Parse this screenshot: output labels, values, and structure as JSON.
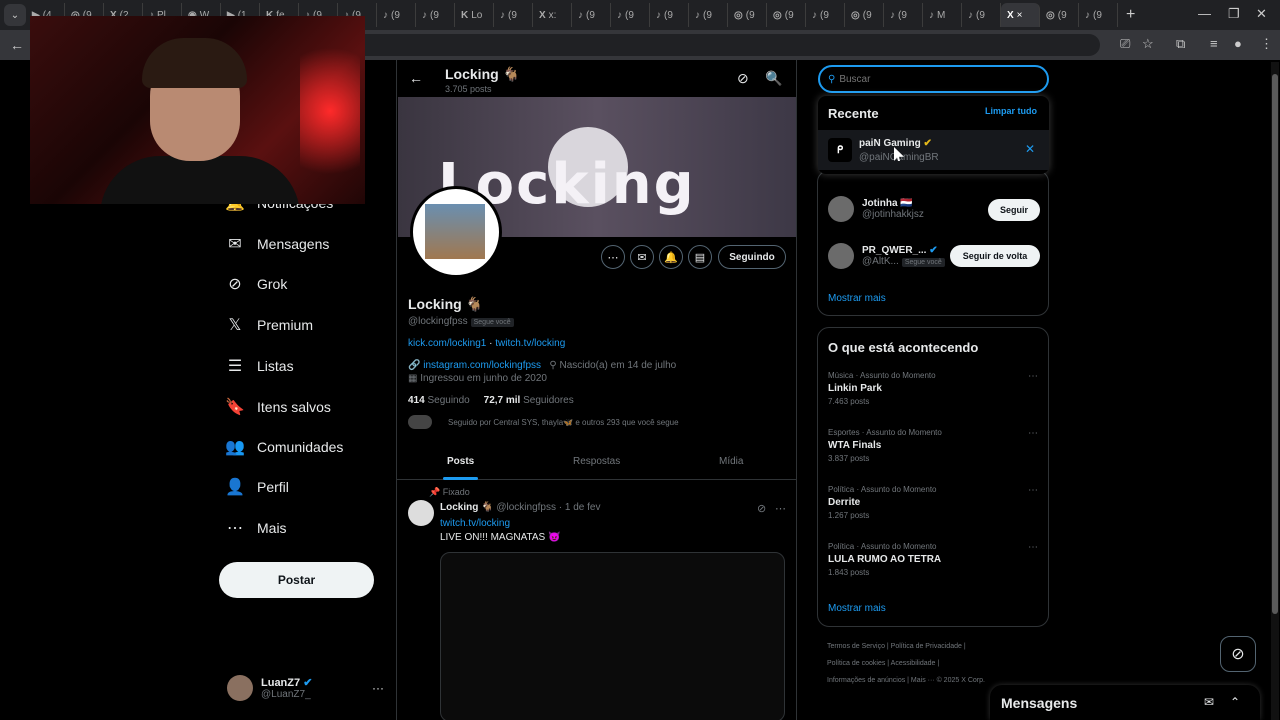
{
  "browser": {
    "tabs": [
      {
        "icon": "▶",
        "label": "(4"
      },
      {
        "icon": "◎",
        "label": "(9"
      },
      {
        "icon": "X",
        "label": "(2"
      },
      {
        "icon": "♪",
        "label": "Pl"
      },
      {
        "icon": "◉",
        "label": "W"
      },
      {
        "icon": "▶",
        "label": "(1"
      },
      {
        "icon": "K",
        "label": "fe"
      },
      {
        "icon": "♪",
        "label": "(9"
      },
      {
        "icon": "♪",
        "label": "(9"
      },
      {
        "icon": "♪",
        "label": "(9"
      },
      {
        "icon": "♪",
        "label": "(9"
      },
      {
        "icon": "K",
        "label": "Lo"
      },
      {
        "icon": "♪",
        "label": "(9"
      },
      {
        "icon": "X",
        "label": "x:"
      },
      {
        "icon": "♪",
        "label": "(9"
      },
      {
        "icon": "♪",
        "label": "(9"
      },
      {
        "icon": "♪",
        "label": "(9"
      },
      {
        "icon": "♪",
        "label": "(9"
      },
      {
        "icon": "◎",
        "label": "(9"
      },
      {
        "icon": "◎",
        "label": "(9"
      },
      {
        "icon": "♪",
        "label": "(9"
      },
      {
        "icon": "◎",
        "label": "(9"
      },
      {
        "icon": "♪",
        "label": "(9"
      },
      {
        "icon": "♪",
        "label": "M"
      },
      {
        "icon": "♪",
        "label": "(9"
      },
      {
        "icon": "X",
        "label": "×"
      },
      {
        "icon": "◎",
        "label": "(9"
      },
      {
        "icon": "♪",
        "label": "(9"
      }
    ],
    "new_tab": "+",
    "back_icon": "←"
  },
  "nav": {
    "items": [
      {
        "icon": "bell-icon",
        "glyph": "🔔",
        "label": "Notificações"
      },
      {
        "icon": "mail-icon",
        "glyph": "✉",
        "label": "Mensagens"
      },
      {
        "icon": "grok-icon",
        "glyph": "⊘",
        "label": "Grok"
      },
      {
        "icon": "x-logo-icon",
        "glyph": "𝕏",
        "label": "Premium"
      },
      {
        "icon": "list-icon",
        "glyph": "☰",
        "label": "Listas"
      },
      {
        "icon": "bookmark-icon",
        "glyph": "🔖",
        "label": "Itens salvos"
      },
      {
        "icon": "communities-icon",
        "glyph": "👥",
        "label": "Comunidades"
      },
      {
        "icon": "profile-icon",
        "glyph": "👤",
        "label": "Perfil"
      },
      {
        "icon": "more-icon",
        "glyph": "⋯",
        "label": "Mais"
      }
    ],
    "post_button": "Postar",
    "account": {
      "name": "LuanZ7",
      "handle": "@LuanZ7_",
      "more": "···"
    }
  },
  "profile": {
    "header_name": "Locking 🐐",
    "post_count": "3.705 posts",
    "banner_text": "Locking",
    "follow_button": "Seguindo",
    "display_name": "Locking 🐐",
    "handle": "@lockingfpss",
    "follows_you": "Segue você",
    "link1": "kick.com/locking1",
    "link_sep": " · ",
    "link2": "twitch.tv/locking",
    "instagram": "instagram.com/lockingfpss",
    "birth": "Nascido(a) em 14 de julho",
    "joined": "Ingressou em junho de 2020",
    "following_count": "414",
    "following_label": "Seguindo",
    "followers_count": "72,7 mil",
    "followers_label": "Seguidores",
    "followed_by": "Seguido por Central SYS, thayla🦋 e outros 293 que você segue",
    "tabs": [
      "Posts",
      "Respostas",
      "Mídia"
    ]
  },
  "tweet": {
    "pinned": "Fixado",
    "author": "Locking 🐐",
    "handle_date": "@lockingfpss · 1 de fev",
    "link": "twitch.tv/locking",
    "text": "LIVE ON!!! MAGNATAS 😈"
  },
  "search": {
    "placeholder": "Buscar",
    "recent_title": "Recente",
    "clear_all": "Limpar tudo",
    "recent_item": {
      "name": "paiN Gaming",
      "handle": "@paiNGamingBR"
    }
  },
  "who_to_follow": {
    "users": [
      {
        "name": "Jotinha 🇳🇱",
        "handle": "@jotinhakkjsz",
        "button": "Seguir"
      },
      {
        "name": "PR_QWER_...",
        "handle": "@AltK...",
        "badge": "Segue você",
        "button": "Seguir de volta"
      }
    ],
    "show_more": "Mostrar mais"
  },
  "trends": {
    "title": "O que está acontecendo",
    "items": [
      {
        "category": "Música · Assunto do Momento",
        "title": "Linkin Park",
        "count": "7.463 posts"
      },
      {
        "category": "Esportes · Assunto do Momento",
        "title": "WTA Finals",
        "count": "3.837 posts"
      },
      {
        "category": "Política · Assunto do Momento",
        "title": "Derrite",
        "count": "1.267 posts"
      },
      {
        "category": "Política · Assunto do Momento",
        "title": "LULA RUMO AO TETRA",
        "count": "1.843 posts"
      }
    ],
    "show_more": "Mostrar mais"
  },
  "footer": {
    "line1": "Termos de Serviço  |  Política de Privacidade  |",
    "line2": "Política de cookies  |  Acessibilidade  |",
    "line3": "Informações de anúncios  |  Mais ···  © 2025 X Corp."
  },
  "messages_bar": {
    "title": "Mensagens"
  }
}
